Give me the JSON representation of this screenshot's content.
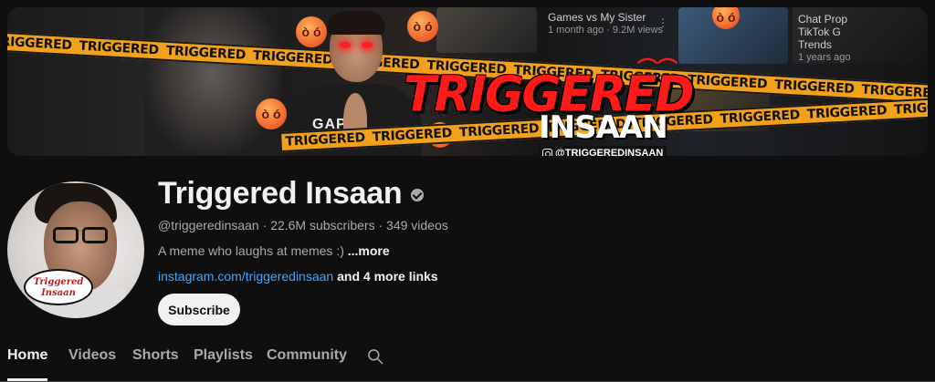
{
  "banner": {
    "title": "TRIGGERED",
    "subtitle": "INSAAN",
    "instagram_handle": "@TRIGGEREDINSAAN",
    "tape_word": "TRIGGERED",
    "bg_video_1_title": "Games vs My Sister",
    "bg_video_1_meta": "1 month ago · 9.2M views",
    "bg_video_2_title": "Chat Prop",
    "bg_video_2_line2": "TikTok G",
    "bg_video_2_line3": "Trends",
    "bg_video_2_meta": "1 years ago",
    "shirt_text": "GAP"
  },
  "channel": {
    "name": "Triggered Insaan",
    "verified": true,
    "handle": "@triggeredinsaan",
    "subscribers": "22.6M subscribers",
    "videos": "349 videos",
    "meta_separator": " · ",
    "description": "A meme who laughs at memes :)",
    "more_label": "...more",
    "link_text": "instagram.com/triggeredinsaan",
    "more_links_label": "and 4 more links",
    "avatar_badge_line1": "Triggered",
    "avatar_badge_line2": "Insaan"
  },
  "actions": {
    "subscribe_label": "Subscribe"
  },
  "tabs": {
    "items": [
      {
        "label": "Home",
        "active": true
      },
      {
        "label": "Videos",
        "active": false
      },
      {
        "label": "Shorts",
        "active": false
      },
      {
        "label": "Playlists",
        "active": false
      },
      {
        "label": "Community",
        "active": false
      }
    ],
    "search_icon": "search-icon"
  },
  "colors": {
    "background": "#0f0f0f",
    "text_primary": "#f1f1f1",
    "text_secondary": "#aaaaaa",
    "link": "#3ea6ff",
    "tape": "#f2a11a",
    "brand_red": "#ff1a1a"
  }
}
